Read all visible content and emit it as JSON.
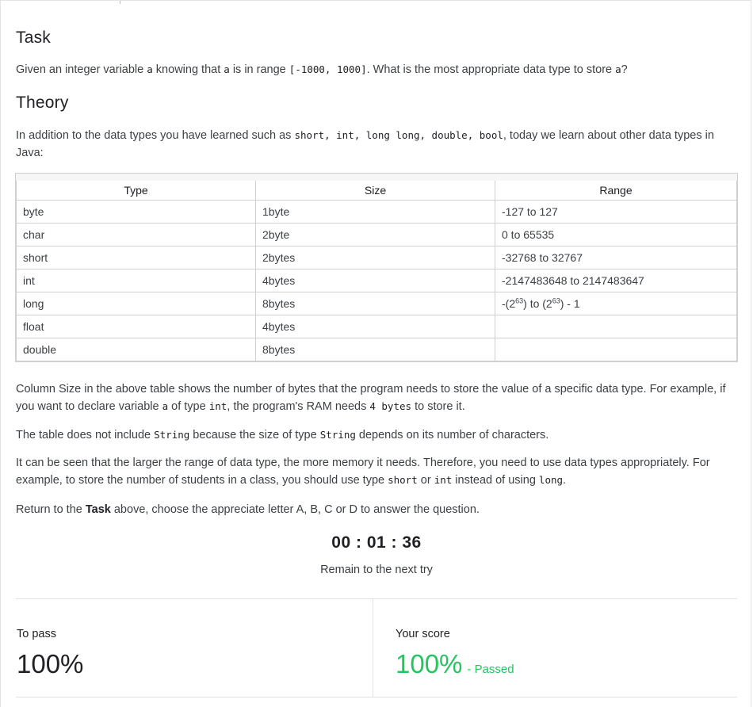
{
  "task": {
    "heading": "Task",
    "text_1": "Given an integer variable ",
    "code_a1": "a",
    "text_2": " knowing that ",
    "code_a2": "a",
    "text_3": " is in range ",
    "code_range": "[-1000, 1000]",
    "text_4": ". What is the most appropriate data type to store ",
    "code_a3": "a",
    "text_5": "?"
  },
  "theory": {
    "heading": "Theory",
    "intro_1": "In addition to the data types you have learned such as ",
    "intro_code": "short, int, long long, double, bool",
    "intro_2": ", today we learn about other data types in Java:",
    "table": {
      "headers": [
        "Type",
        "Size",
        "Range"
      ],
      "rows": [
        [
          "byte",
          "1byte",
          "-127 to 127"
        ],
        [
          "char",
          "2byte",
          "0 to 65535"
        ],
        [
          "short",
          "2bytes",
          "-32768 to 32767"
        ],
        [
          "int",
          "4bytes",
          "-2147483648 to 2147483647"
        ],
        [
          "long",
          "8bytes",
          ""
        ],
        [
          "float",
          "4bytes",
          ""
        ],
        [
          "double",
          "8bytes",
          ""
        ]
      ],
      "long_range": {
        "part_1": "-(2",
        "exp_1": "63",
        "part_2": ") to (2",
        "exp_2": "63",
        "part_3": ") - 1"
      }
    },
    "p1_a": "Column Size in the above table shows the number of bytes that the program needs to store the value of a specific data type. For example, if you want to declare variable ",
    "p1_code_a": "a",
    "p1_b": " of type ",
    "p1_code_int": "int",
    "p1_c": ", the program's RAM needs ",
    "p1_code_bytes": "4 bytes",
    "p1_d": " to store it.",
    "p2_a": "The table does not include ",
    "p2_code_1": "String",
    "p2_b": " because the size of type ",
    "p2_code_2": "String",
    "p2_c": " depends on its number of characters.",
    "p3_a": "It can be seen that the larger the range of data type, the more memory it needs. Therefore, you need to use data types appropriately. For example, to store the number of students in a class, you should use type ",
    "p3_code_short": "short",
    "p3_b": " or ",
    "p3_code_int": "int",
    "p3_c": " instead of using ",
    "p3_code_long": "long",
    "p3_d": ".",
    "p4_a": "Return to the ",
    "p4_bold": "Task",
    "p4_b": " above, choose the appreciate letter A, B, C or D to answer the question."
  },
  "timer": {
    "value": "00 : 01 : 36",
    "label": "Remain to the next try"
  },
  "result": {
    "pass_label": "To pass",
    "pass_value": "100%",
    "score_label": "Your score",
    "score_value": "100%",
    "score_status": "- Passed",
    "score_color": "#22c55e"
  }
}
